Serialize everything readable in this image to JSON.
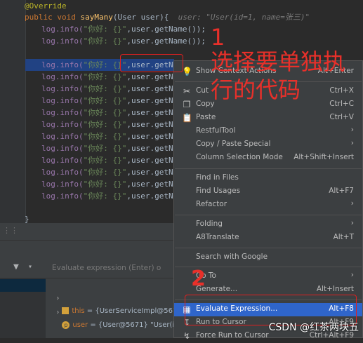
{
  "editor": {
    "annotation": "@Override",
    "signature": {
      "modifier": "public void",
      "method": "sayMany",
      "params": "(User user){",
      "hint": "user: \"User(id=1, name=张三)\""
    },
    "lines": [
      {
        "obj": "log.info(",
        "str": "\"你好: {}\"",
        "rest": ",user.getName());"
      },
      {
        "obj": "log.info(",
        "str": "\"你好: {}\"",
        "rest": ",user.getName());"
      },
      {
        "obj": "log.info(",
        "str": "\"你好: {}\"",
        "rest": ",user.getName"
      },
      {
        "obj": "log.info(",
        "str": "\"你好: {}\"",
        "rest": ",user.getName"
      },
      {
        "obj": "log.info(",
        "str": "\"你好: {}\"",
        "rest": ",user.getName"
      },
      {
        "obj": "log.info(",
        "str": "\"你好: {}\"",
        "rest": ",user.getName"
      },
      {
        "obj": "log.info(",
        "str": "\"你好: {}\"",
        "rest": ",user.getName"
      },
      {
        "obj": "log.info(",
        "str": "\"你好: {}\"",
        "rest": ",user.getName"
      },
      {
        "obj": "log.info(",
        "str": "\"你好: {}\"",
        "rest": ",user.getName"
      },
      {
        "obj": "log.info(",
        "str": "\"你好: {}\"",
        "rest": ",user.getName"
      },
      {
        "obj": "log.info(",
        "str": "\"你好: {}\"",
        "rest": ",user.getName"
      },
      {
        "obj": "log.info(",
        "str": "\"你好: {}\"",
        "rest": ",user.getName"
      },
      {
        "obj": "log.info(",
        "str": "\"你好: {}\"",
        "rest": ",user.getName"
      },
      {
        "obj": "log.info(",
        "str": "\"你好: {}\"",
        "rest": ",user.getName"
      }
    ],
    "closing_brace": "}"
  },
  "debug": {
    "evaluate_placeholder": "Evaluate expression (Enter) o",
    "variables": [
      {
        "name": "this",
        "value": "= {UserServiceImpl@567"
      },
      {
        "name": "user",
        "value": "= {User@5671} \"User(id"
      }
    ]
  },
  "context_menu": {
    "items": [
      {
        "label": "Show Context Actions",
        "shortcut": "Alt+Enter",
        "icon": "bulb-icon"
      },
      {
        "label": "Cut",
        "shortcut": "Ctrl+X",
        "icon": "scissors-icon"
      },
      {
        "label": "Copy",
        "shortcut": "Ctrl+C",
        "icon": "copy-icon"
      },
      {
        "label": "Paste",
        "shortcut": "Ctrl+V",
        "icon": "clipboard-icon"
      },
      {
        "label": "RestfulTool",
        "shortcut": "",
        "submenu": true
      },
      {
        "label": "Copy / Paste Special",
        "shortcut": "",
        "submenu": true
      },
      {
        "label": "Column Selection Mode",
        "shortcut": "Alt+Shift+Insert"
      },
      {
        "label": "Find in Files",
        "shortcut": ""
      },
      {
        "label": "Find Usages",
        "shortcut": "Alt+F7"
      },
      {
        "label": "Refactor",
        "shortcut": "",
        "submenu": true
      },
      {
        "label": "Folding",
        "shortcut": "",
        "submenu": true
      },
      {
        "label": "A8Translate",
        "shortcut": "Alt+T"
      },
      {
        "label": "Search with Google",
        "shortcut": ""
      },
      {
        "label": "Go To",
        "shortcut": "",
        "submenu": true
      },
      {
        "label": "Generate...",
        "shortcut": "Alt+Insert"
      },
      {
        "label": "Evaluate Expression...",
        "shortcut": "Alt+F8",
        "icon": "calculator-icon",
        "active": true
      },
      {
        "label": "Run to Cursor",
        "shortcut": "Alt+F9",
        "icon": "run-to-cursor-icon"
      },
      {
        "label": "Force Run to Cursor",
        "shortcut": "Ctrl+Alt+F9",
        "icon": "force-run-icon"
      }
    ]
  },
  "annotations": {
    "step1_number": "1",
    "step1_text_line1": "选择要单独执",
    "step1_text_line2": "行的代码",
    "step2_number": "2"
  },
  "watermark": "CSDN @红茶两块五",
  "colors": {
    "annotation_red": "#e8302a",
    "menu_active": "#2f65ca",
    "selection": "#214283"
  }
}
